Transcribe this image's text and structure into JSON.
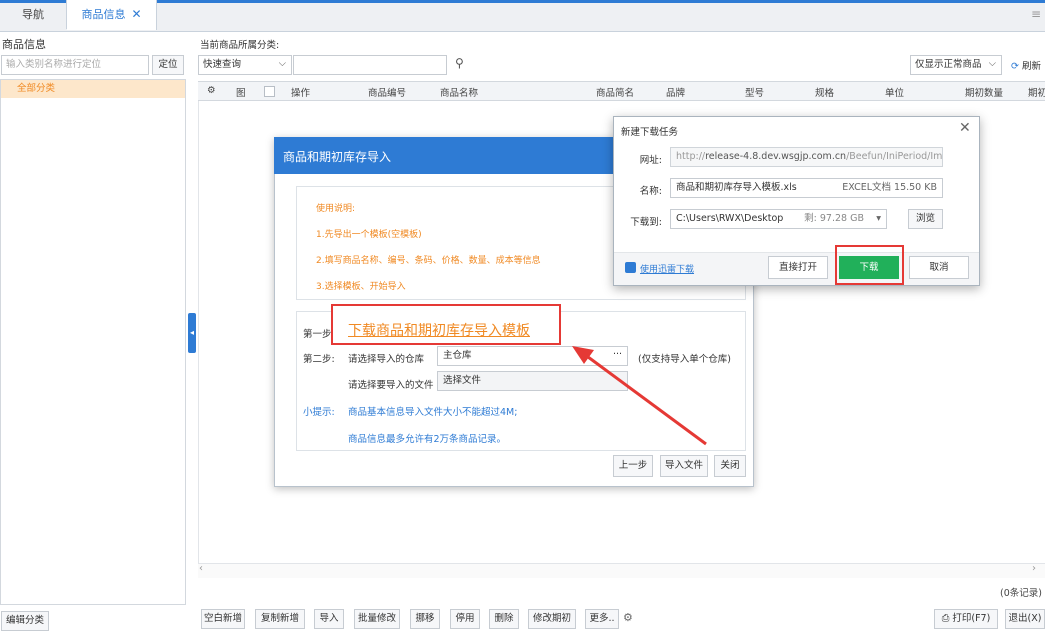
{
  "tabs": {
    "nav": "导航",
    "goods": "商品信息",
    "close": "✕"
  },
  "left": {
    "title": "商品信息",
    "search_placeholder": "输入类别名称进行定位",
    "locate": "定位",
    "tree_all": "全部分类",
    "edit_category": "编辑分类"
  },
  "toolbar": {
    "category_label": "当前商品所属分类:",
    "quick_query": "快速查询",
    "normal_only": "仅显示正常商品",
    "refresh": "刷新"
  },
  "grid": {
    "columns": {
      "image": "图",
      "action": "操作",
      "code": "商品编号",
      "name": "商品名称",
      "alias": "商品简名",
      "brand": "品牌",
      "model": "型号",
      "spec": "规格",
      "unit": "单位",
      "init_qty": "期初数量",
      "init_more": "期初"
    },
    "record_count": "(0条记录)"
  },
  "bottom_buttons": {
    "blank_new": "空白新增",
    "copy_new": "复制新增",
    "import": "导入",
    "batch_edit": "批量修改",
    "move": "挪移",
    "disable": "停用",
    "delete": "删除",
    "edit_init": "修改期初",
    "more": "更多..",
    "print": "打印(F7)",
    "exit": "退出(X)"
  },
  "import_dialog": {
    "title": "商品和期初库存导入",
    "instructions": [
      "使用说明:",
      "1.先导出一个模板(空模板)",
      "2.填写商品名称、编号、条码、价格、数量、成本等信息",
      "3.选择模板、开始导入"
    ],
    "step1_label": "第一步:",
    "download_link": "下载商品和期初库存导入模板",
    "step2_label": "第二步:",
    "warehouse_label": "请选择导入的仓库",
    "warehouse_value": "主仓库",
    "warehouse_note": "(仅支持导入单个仓库)",
    "file_label": "请选择要导入的文件",
    "file_value": "选择文件",
    "tip_label": "小提示:",
    "tip1": "商品基本信息导入文件大小不能超过4M;",
    "tip2": "商品信息最多允许有2万条商品记录。",
    "prev": "上一步",
    "import_file": "导入文件",
    "close": "关闭"
  },
  "download_dialog": {
    "title": "新建下载任务",
    "url_label": "网址:",
    "url_prefix": "http://",
    "url_host": "release-4.8.dev.wsgjp.com.cn",
    "url_path": "/Beefun/IniPeriod/Impc",
    "name_label": "名称:",
    "file_name": "商品和期初库存导入模板.xls",
    "file_meta": "EXCEL文档 15.50 KB",
    "save_label": "下载到:",
    "save_path": "C:\\Users\\RWX\\Desktop",
    "free_space": "剩: 97.28 GB",
    "browse": "浏览",
    "xunlei": "使用迅雷下载",
    "open_direct": "直接打开",
    "download": "下载",
    "cancel": "取消"
  },
  "colors": {
    "accent": "#2e7bd4",
    "orange": "#f08a24",
    "highlight": "#e53935",
    "green": "#21b05a"
  }
}
